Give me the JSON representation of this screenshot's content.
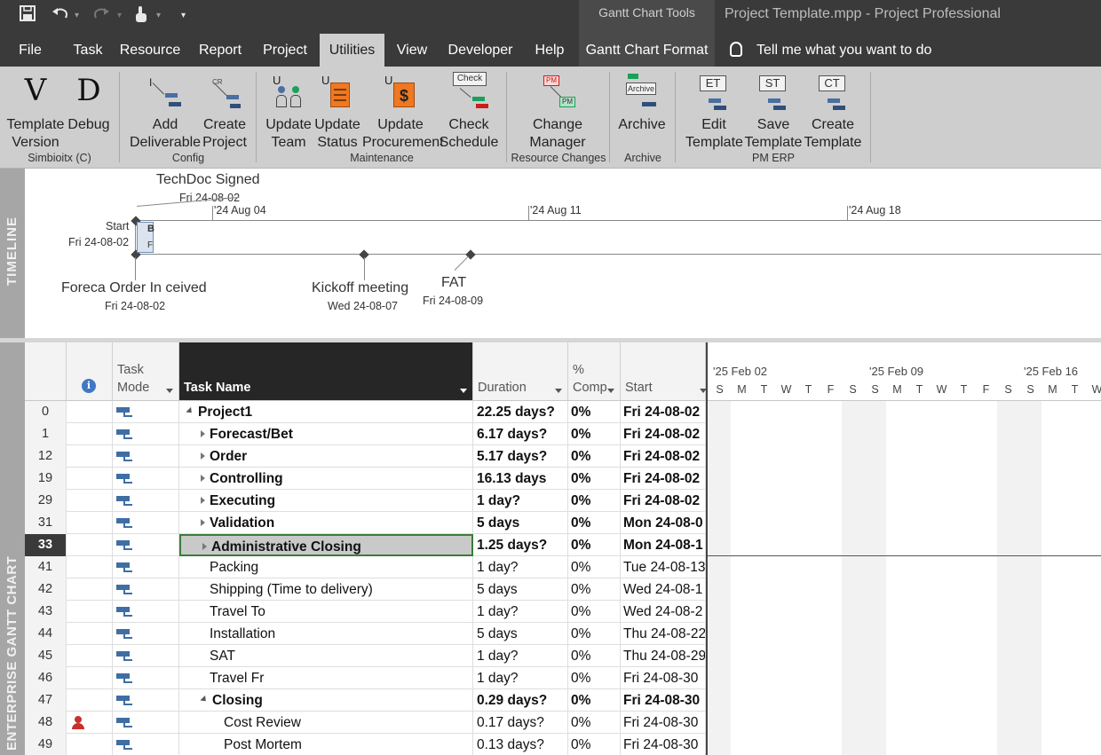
{
  "titlebar": {
    "contextual_tab_group": "Gantt Chart Tools",
    "window_title": "Project Template.mpp  -  Project Professional"
  },
  "tabs": [
    {
      "label": "File"
    },
    {
      "label": "Task"
    },
    {
      "label": "Resource"
    },
    {
      "label": "Report"
    },
    {
      "label": "Project"
    },
    {
      "label": "Utilities"
    },
    {
      "label": "View"
    },
    {
      "label": "Developer"
    },
    {
      "label": "Help"
    },
    {
      "label": "Gantt Chart Format"
    }
  ],
  "active_tab": "Utilities",
  "tell_me": "Tell me what you want to do",
  "ribbon": {
    "groups": [
      {
        "label": "Simbioitx (C)"
      },
      {
        "label": "Config"
      },
      {
        "label": "Maintenance"
      },
      {
        "label": "Resource Changes"
      },
      {
        "label": "Archive"
      },
      {
        "label": "PM ERP"
      }
    ],
    "buttons": {
      "template_version": {
        "line1": "Template",
        "line2": "Version",
        "icon_text": "V"
      },
      "debug": {
        "line1": "Debug",
        "line2": "",
        "icon_text": "D"
      },
      "add_deliverable": {
        "line1": "Add",
        "line2": "Deliverable",
        "icon_text": "I"
      },
      "create_project": {
        "line1": "Create",
        "line2": "Project",
        "icon_text": "CR"
      },
      "update_team": {
        "line1": "Update",
        "line2": "Team",
        "icon_text": "U"
      },
      "update_status": {
        "line1": "Update",
        "line2": "Status",
        "icon_text": "U"
      },
      "update_procurement": {
        "line1": "Update",
        "line2": "Procurement",
        "icon_text": "U"
      },
      "check_schedule": {
        "line1": "Check",
        "line2": "Schedule",
        "icon_text": "Check"
      },
      "change_manager": {
        "line1": "Change",
        "line2": "Manager",
        "icon_text": "PM"
      },
      "archive": {
        "line1": "Archive",
        "line2": "",
        "icon_text": "Archive"
      },
      "edit_template": {
        "line1": "Edit",
        "line2": "Template",
        "icon_text": "ET"
      },
      "save_template": {
        "line1": "Save",
        "line2": "Template",
        "icon_text": "ST"
      },
      "create_template": {
        "line1": "Create",
        "line2": "Template",
        "icon_text": "CT"
      }
    }
  },
  "timeline": {
    "side_label": "TIMELINE",
    "dates": [
      "'24 Aug 04",
      "'24 Aug 11",
      "'24 Aug 18"
    ],
    "milestones": {
      "techdoc": {
        "name": "TechDoc Signed",
        "date": "Fri 24-08-02"
      },
      "start": {
        "name": "Start",
        "date": "Fri 24-08-02"
      },
      "order": {
        "name": "Foreca Order In ceived",
        "date": "Fri 24-08-02"
      },
      "kickoff": {
        "name": "Kickoff meeting",
        "date": "Wed 24-08-07"
      },
      "fat": {
        "name": "FAT",
        "date": "Fri 24-08-09"
      }
    },
    "bar_text": {
      "top": "B",
      "bottom": "F"
    }
  },
  "gantt": {
    "side_label": "ENTERPRISE GANTT CHART",
    "columns": {
      "info": "i",
      "task_mode": "Task Mode",
      "task_name": "Task Name",
      "duration": "Duration",
      "pct": "% Comp",
      "start": "Start"
    },
    "rows": [
      {
        "id": "0",
        "name": "Project1",
        "duration": "22.25 days?",
        "pct": "0%",
        "start": "Fri 24-08-02",
        "level": 0,
        "bold": true,
        "toggle": "down"
      },
      {
        "id": "1",
        "name": "Forecast/Bet",
        "duration": "6.17 days?",
        "pct": "0%",
        "start": "Fri 24-08-02",
        "level": 1,
        "bold": true,
        "toggle": "right"
      },
      {
        "id": "12",
        "name": "Order",
        "duration": "5.17 days?",
        "pct": "0%",
        "start": "Fri 24-08-02",
        "level": 1,
        "bold": true,
        "toggle": "right"
      },
      {
        "id": "19",
        "name": "Controlling",
        "duration": "16.13 days",
        "pct": "0%",
        "start": "Fri 24-08-02",
        "level": 1,
        "bold": true,
        "toggle": "right"
      },
      {
        "id": "29",
        "name": "Executing",
        "duration": "1 day?",
        "pct": "0%",
        "start": "Fri 24-08-02",
        "level": 1,
        "bold": true,
        "toggle": "right"
      },
      {
        "id": "31",
        "name": "Validation",
        "duration": "5 days",
        "pct": "0%",
        "start": "Mon 24-08-0",
        "level": 1,
        "bold": true,
        "toggle": "right"
      },
      {
        "id": "33",
        "name": "Administrative Closing",
        "duration": "1.25 days?",
        "pct": "0%",
        "start": "Mon 24-08-1",
        "level": 1,
        "bold": true,
        "toggle": "right",
        "selected": true
      },
      {
        "id": "41",
        "name": "Packing",
        "duration": "1 day?",
        "pct": "0%",
        "start": "Tue 24-08-13",
        "level": 1,
        "bold": false,
        "toggle": ""
      },
      {
        "id": "42",
        "name": "Shipping (Time to delivery)",
        "duration": "5 days",
        "pct": "0%",
        "start": "Wed 24-08-1",
        "level": 1,
        "bold": false,
        "toggle": ""
      },
      {
        "id": "43",
        "name": "Travel To",
        "duration": "1 day?",
        "pct": "0%",
        "start": "Wed 24-08-2",
        "level": 1,
        "bold": false,
        "toggle": ""
      },
      {
        "id": "44",
        "name": "Installation",
        "duration": "5 days",
        "pct": "0%",
        "start": "Thu 24-08-22",
        "level": 1,
        "bold": false,
        "toggle": ""
      },
      {
        "id": "45",
        "name": "SAT",
        "duration": "1 day?",
        "pct": "0%",
        "start": "Thu 24-08-29",
        "level": 1,
        "bold": false,
        "toggle": ""
      },
      {
        "id": "46",
        "name": "Travel Fr",
        "duration": "1 day?",
        "pct": "0%",
        "start": "Fri 24-08-30",
        "level": 1,
        "bold": false,
        "toggle": ""
      },
      {
        "id": "47",
        "name": "Closing",
        "duration": "0.29 days?",
        "pct": "0%",
        "start": "Fri 24-08-30",
        "level": 1,
        "bold": true,
        "toggle": "down"
      },
      {
        "id": "48",
        "name": "Cost Review",
        "duration": "0.17 days?",
        "pct": "0%",
        "start": "Fri 24-08-30",
        "level": 2,
        "bold": false,
        "toggle": "",
        "indicator": "resource-person-icon"
      },
      {
        "id": "49",
        "name": "Post Mortem",
        "duration": "0.13 days?",
        "pct": "0%",
        "start": "Fri 24-08-30",
        "level": 2,
        "bold": false,
        "toggle": ""
      }
    ]
  },
  "chart": {
    "weeks": [
      "'25 Feb 02",
      "'25 Feb 09",
      "'25 Feb 16"
    ],
    "days": [
      "S",
      "M",
      "T",
      "W",
      "T",
      "F",
      "S",
      "S",
      "M",
      "T",
      "W",
      "T",
      "F",
      "S",
      "S",
      "M",
      "T",
      "W"
    ]
  }
}
